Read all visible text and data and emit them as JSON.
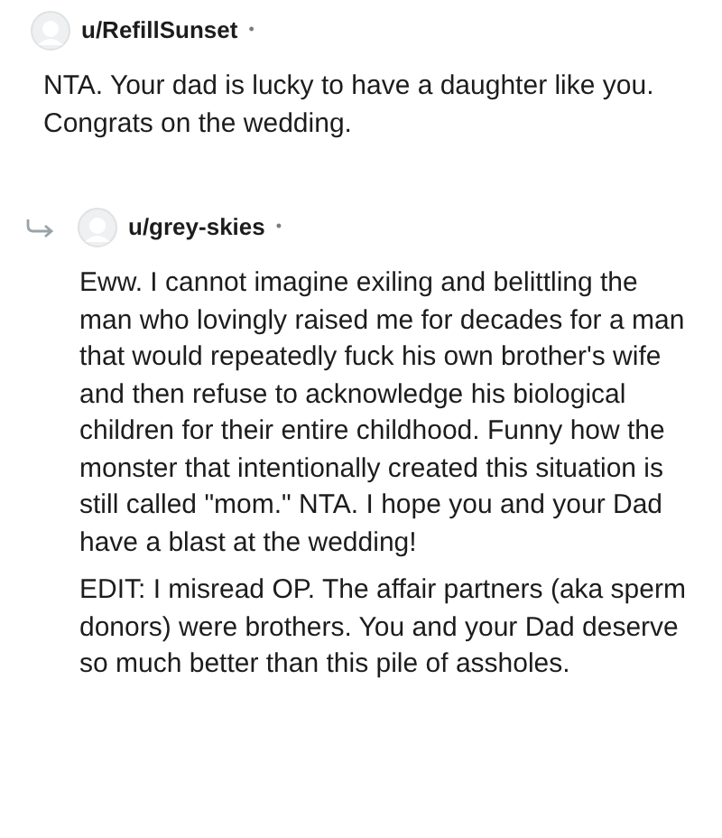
{
  "comments": [
    {
      "username": "u/RefillSunset",
      "separator": "•",
      "reply": false,
      "paragraphs": [
        "NTA. Your dad is lucky to have a daughter like you. Congrats on the wedding."
      ]
    },
    {
      "username": "u/grey-skies",
      "separator": "•",
      "reply": true,
      "paragraphs": [
        "Eww. I cannot imagine exiling and belittling the man who lovingly raised me for decades for a man that would repeatedly fuck his own brother's wife and then refuse to acknowledge his biological children for their entire childhood. Funny how the monster that intentionally created this situation is still called \"mom.\" NTA. I hope you and your Dad have a blast at the wedding!",
        "EDIT: I misread OP. The affair partners (aka sperm donors) were brothers. You and your Dad deserve so much better than this pile of assholes."
      ]
    }
  ]
}
